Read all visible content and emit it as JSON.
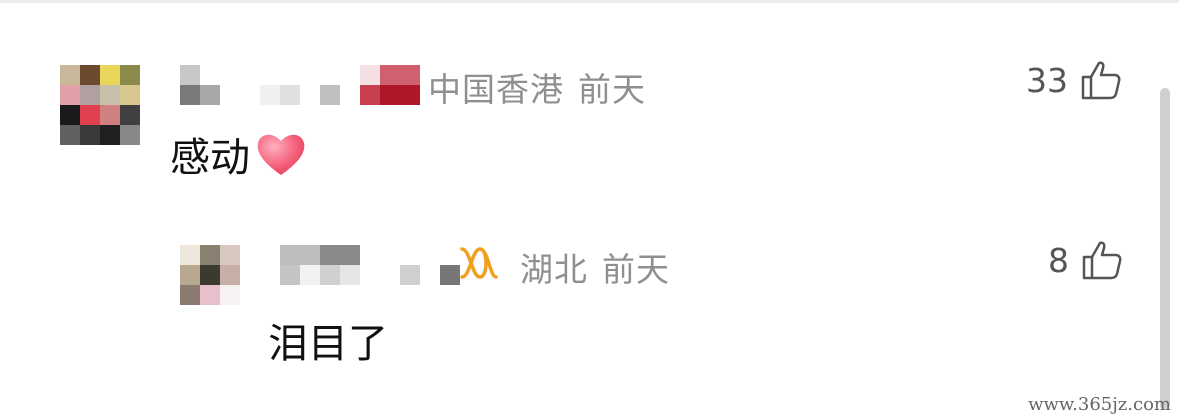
{
  "comments": [
    {
      "location": "中国香港",
      "time": "前天",
      "likes": "33",
      "text": "感动",
      "emoji": "heart-emoji"
    },
    {
      "location": "湖北",
      "time": "前天",
      "likes": "8",
      "text": "泪目了",
      "badge": "orange-infinity-badge"
    }
  ],
  "watermark": "www.365jz.com",
  "icons": {
    "like": "thumbs-up-outline-icon",
    "heart": "heart-emoji"
  },
  "colors": {
    "meta_text": "#8f8f8f",
    "body_text": "#111111",
    "badge_orange": "#f0a020",
    "heart_red": "#f4607a"
  }
}
